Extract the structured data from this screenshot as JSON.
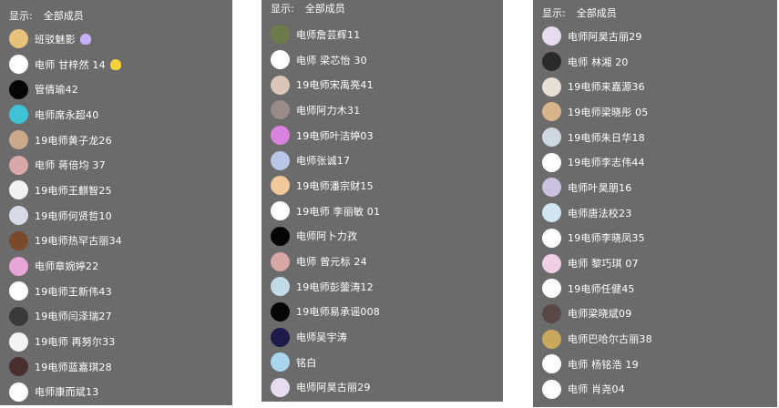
{
  "panels": [
    {
      "show_label": "显示:",
      "filter": "全部成员",
      "members": [
        {
          "name": "班驳魅影",
          "avatar": "#e8c27a",
          "badge": "#c8b0ff"
        },
        {
          "name": "电师 甘梓然 14",
          "avatar": "#ffffff",
          "badge": "#f5d23a"
        },
        {
          "name": "管倩瑜42",
          "avatar": "#050505"
        },
        {
          "name": "电师席永超40",
          "avatar": "#3fc2d6"
        },
        {
          "name": "19电师黄子龙26",
          "avatar": "#caa88c"
        },
        {
          "name": "电师 蒋倍均 37",
          "avatar": "#d8a8a8"
        },
        {
          "name": "19电师王麒智25",
          "avatar": "#f2f2f2"
        },
        {
          "name": "19电师何贤哲10",
          "avatar": "#d9d9e6"
        },
        {
          "name": "19电师热罕古丽34",
          "avatar": "#7a4a2a"
        },
        {
          "name": "电师章婉婷22",
          "avatar": "#e7a7d6"
        },
        {
          "name": "19电师王新伟43",
          "avatar": "#ffffff"
        },
        {
          "name": "19电师闫泽瑞27",
          "avatar": "#3a3a3a"
        },
        {
          "name": "19电师 再努尔33",
          "avatar": "#f4f4f4"
        },
        {
          "name": "19电师蓝嘉琪28",
          "avatar": "#4a2f2f"
        },
        {
          "name": "电师康而斌13",
          "avatar": "#ffffff"
        }
      ]
    },
    {
      "show_label": "显示:",
      "filter": "全部成员",
      "members": [
        {
          "name": "电师詹芸辉11",
          "avatar": "#6d7a4a"
        },
        {
          "name": "电师 梁芯怡 30",
          "avatar": "#ffffff"
        },
        {
          "name": "19电师宋禹亮41",
          "avatar": "#d9c6b8"
        },
        {
          "name": "电师阿力木31",
          "avatar": "#9a8a8a"
        },
        {
          "name": "19电师叶洁婷03",
          "avatar": "#d982e0"
        },
        {
          "name": "电师张诚17",
          "avatar": "#b9c6e6"
        },
        {
          "name": "19电师潘宗财15",
          "avatar": "#f0c89a"
        },
        {
          "name": "19电师 李丽敏 01",
          "avatar": "#ffffff"
        },
        {
          "name": "电师阿卜力孜",
          "avatar": "#050505"
        },
        {
          "name": "电师 曾元标 24",
          "avatar": "#d9a6a6"
        },
        {
          "name": "19电师彭蓥涛12",
          "avatar": "#c2d9e6"
        },
        {
          "name": "19电师易承谣008",
          "avatar": "#050505"
        },
        {
          "name": "电师吴宇涛",
          "avatar": "#1e1a4a"
        },
        {
          "name": "铭白",
          "avatar": "#a9d6ef"
        },
        {
          "name": "电师阿昊古丽29",
          "avatar": "#e6dcf0"
        }
      ]
    },
    {
      "show_label": "显示:",
      "filter": "全部成员",
      "members": [
        {
          "name": "电师阿昊古丽29",
          "avatar": "#e6dcf0"
        },
        {
          "name": "电师 林湘 20",
          "avatar": "#2a2a2a"
        },
        {
          "name": "19电师来嘉源36",
          "avatar": "#e6dfd4"
        },
        {
          "name": "19电师梁晓彤 05",
          "avatar": "#d8b48c"
        },
        {
          "name": "19电师朱日华18",
          "avatar": "#cfd8e0"
        },
        {
          "name": "19电师李志伟44",
          "avatar": "#ffffff"
        },
        {
          "name": "电师叶昊朋16",
          "avatar": "#c8c2e0"
        },
        {
          "name": "电师唐法校23",
          "avatar": "#cfe6f2"
        },
        {
          "name": "19电师李晓凤35",
          "avatar": "#ffffff"
        },
        {
          "name": "电师 黎巧琪 07",
          "avatar": "#f0cfe6"
        },
        {
          "name": "19电师任健45",
          "avatar": "#ffffff"
        },
        {
          "name": "电师梁晓斌09",
          "avatar": "#5a4848"
        },
        {
          "name": "电师巴哈尔古丽38",
          "avatar": "#c8a85a"
        },
        {
          "name": "电师 杨铭浩 19",
          "avatar": "#ffffff"
        },
        {
          "name": "电师 肖尧04",
          "avatar": "#ffffff"
        }
      ]
    }
  ]
}
